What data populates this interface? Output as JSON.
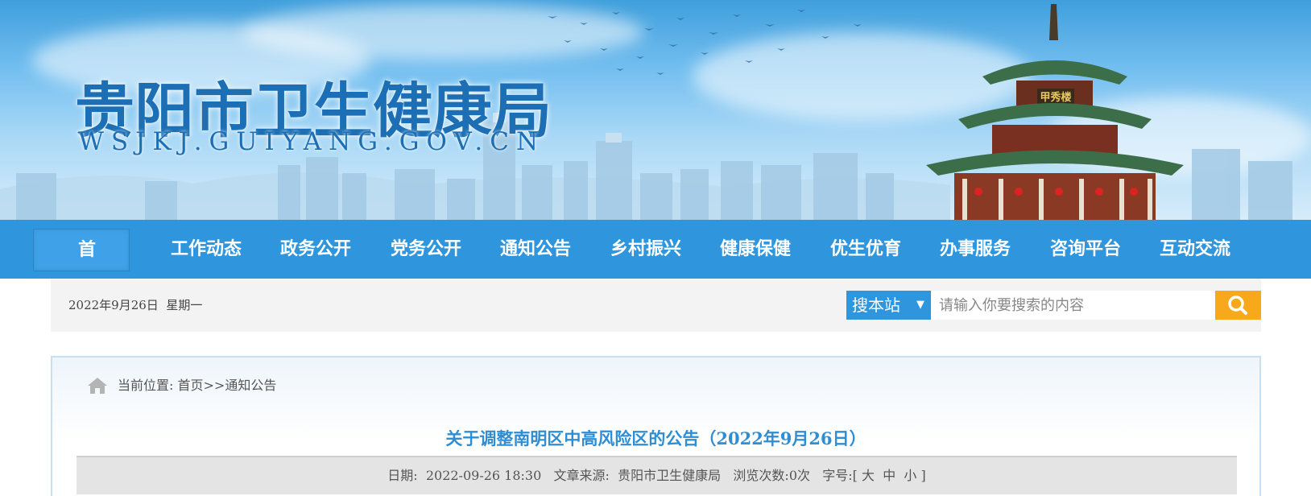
{
  "banner": {
    "site_title": "贵阳市卫生健康局",
    "site_domain": "WSJKJ.GUIYANG.GOV.CN",
    "tower_plaque": "甲秀楼"
  },
  "nav": {
    "items": [
      {
        "label": "首页"
      },
      {
        "label": "工作动态"
      },
      {
        "label": "政务公开"
      },
      {
        "label": "党务公开"
      },
      {
        "label": "通知公告"
      },
      {
        "label": "乡村振兴"
      },
      {
        "label": "健康保健"
      },
      {
        "label": "优生优育"
      },
      {
        "label": "办事服务"
      },
      {
        "label": "咨询平台"
      },
      {
        "label": "互动交流"
      }
    ],
    "active_index": 0
  },
  "infobar": {
    "date": "2022年9月26日",
    "weekday": "星期一",
    "search_scope": "搜本站",
    "search_placeholder": "请输入你要搜索的内容",
    "search_icon": "search-icon"
  },
  "breadcrumb": {
    "label": "当前位置:",
    "home": "首页",
    "separator": ">>",
    "current": "通知公告"
  },
  "article": {
    "title": "关于调整南明区中高风险区的公告（2022年9月26日）",
    "date_label": "日期:",
    "date": "2022-09-26 18:30",
    "source_label": "文章来源:",
    "source": "贵阳市卫生健康局",
    "views_label": "浏览次数:",
    "views": "0次",
    "font_label": "字号:",
    "bracket_open": "[",
    "font_large": "大",
    "font_medium": "中",
    "font_small": "小",
    "bracket_close": "]"
  },
  "colors": {
    "nav_bg": "#2f95dd",
    "title_blue": "#2f8ed3",
    "search_button": "#f7a81b"
  }
}
